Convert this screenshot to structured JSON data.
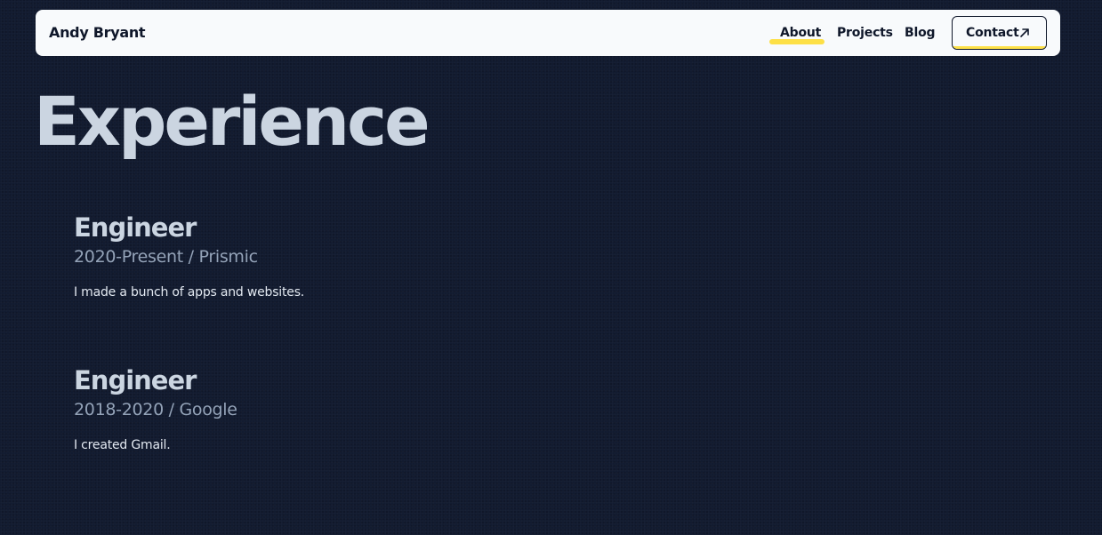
{
  "header": {
    "brand": "Andy Bryant",
    "nav": {
      "about": "About",
      "projects": "Projects",
      "blog": "Blog",
      "contact": "Contact"
    },
    "active_tab": "About",
    "accent_color": "#fde047"
  },
  "main": {
    "title": "Experience",
    "jobs": [
      {
        "title": "Engineer",
        "period": "2020-Present",
        "company": "Prismic",
        "description": "I made a bunch of apps and websites."
      },
      {
        "title": "Engineer",
        "period": "2018-2020",
        "company": "Google",
        "description": "I created Gmail."
      }
    ]
  },
  "icons": {
    "contact": "arrow-up-right-icon"
  }
}
